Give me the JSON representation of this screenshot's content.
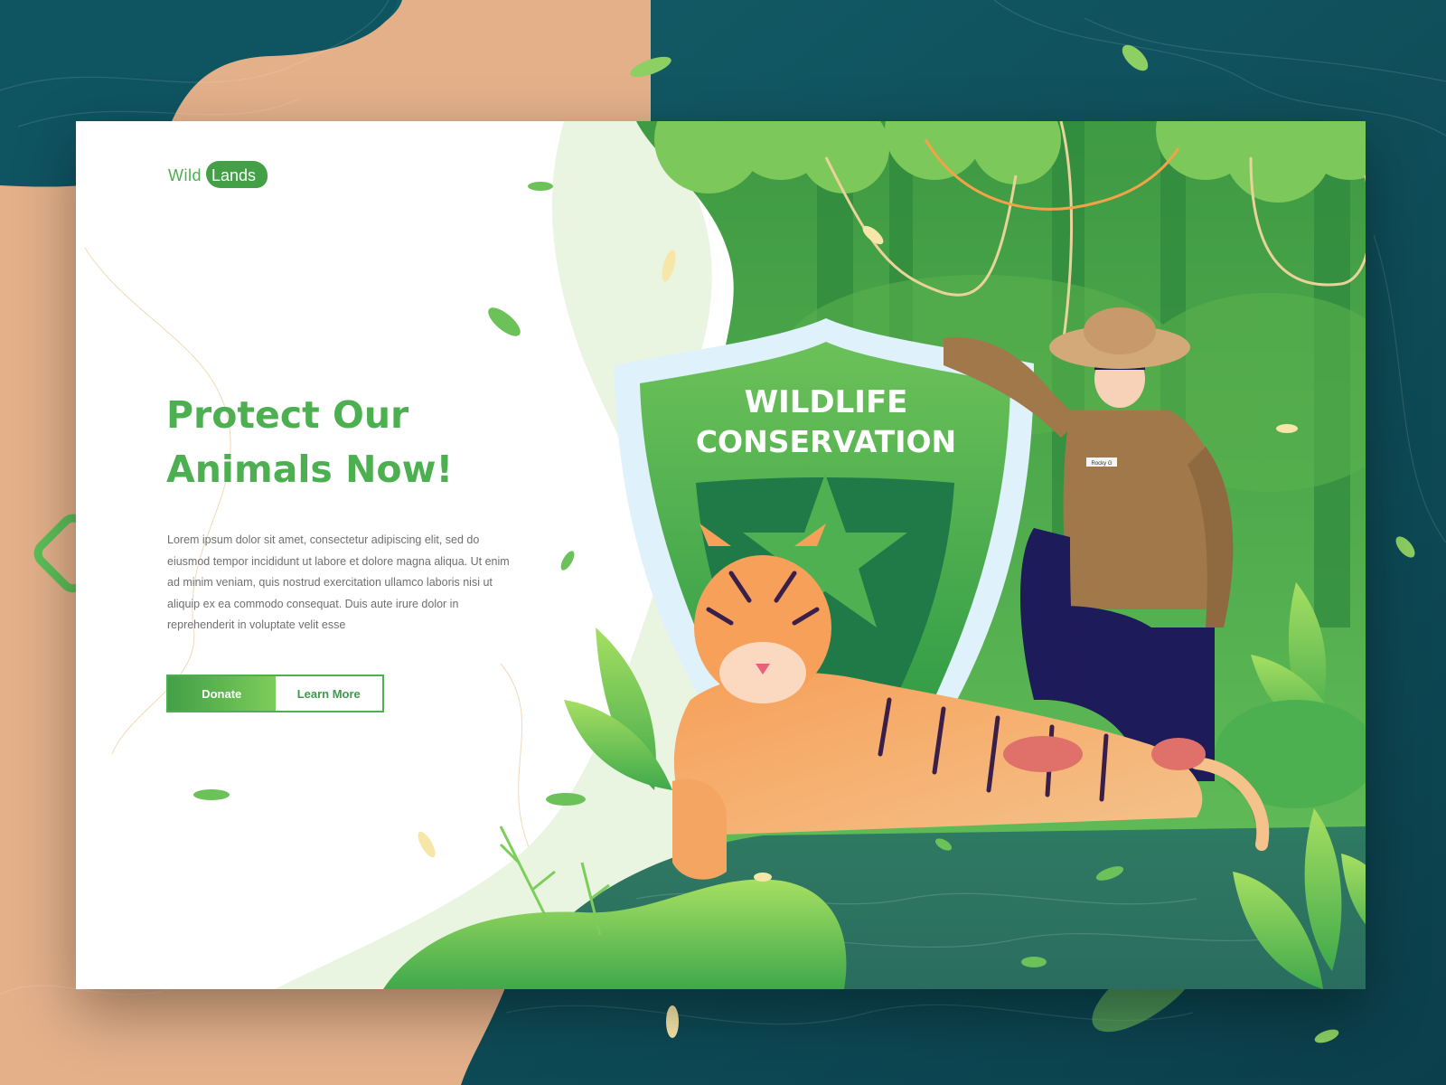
{
  "brand": {
    "logo_part1": "Wild",
    "logo_part2": "Lands"
  },
  "hero": {
    "headline": "Protect Our\nAnimals Now!",
    "body": "Lorem ipsum dolor sit amet, consectetur adipiscing elit, sed do eiusmod tempor incididunt ut labore et dolore magna aliqua. Ut enim ad minim veniam, quis nostrud exercitation ullamco laboris nisi ut aliquip ex ea commodo consequat. Duis aute irure dolor in reprehenderit in voluptate velit esse",
    "donate_label": "Donate",
    "learn_more_label": "Learn More"
  },
  "illustration": {
    "shield_line1": "WILDLIFE",
    "shield_line2": "CONSERVATION",
    "ranger_name_tag": "Rocky G"
  },
  "colors": {
    "brand_green": "#4caf50",
    "dark_teal": "#0e4a56",
    "sand": "#e3b08a",
    "body_text": "#6f6f6f"
  }
}
